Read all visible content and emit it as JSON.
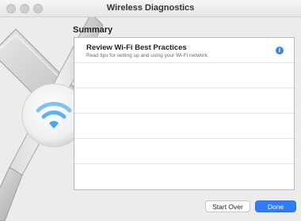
{
  "window": {
    "title": "Wireless Diagnostics"
  },
  "summary": {
    "heading": "Summary",
    "items": [
      {
        "title": "Review Wi-Fi Best Practices",
        "subtitle": "Read tips for setting up and using your Wi-Fi network.",
        "icon": "info-icon"
      }
    ]
  },
  "buttons": {
    "start_over": "Start Over",
    "done": "Done"
  },
  "colors": {
    "accent": "#2f7cf6",
    "wifi_glyph": "#3ea8f2"
  },
  "icons": [
    "close-icon",
    "minimize-icon",
    "zoom-icon",
    "wrench-icon",
    "screwdriver-icon",
    "wifi-icon",
    "info-icon"
  ]
}
